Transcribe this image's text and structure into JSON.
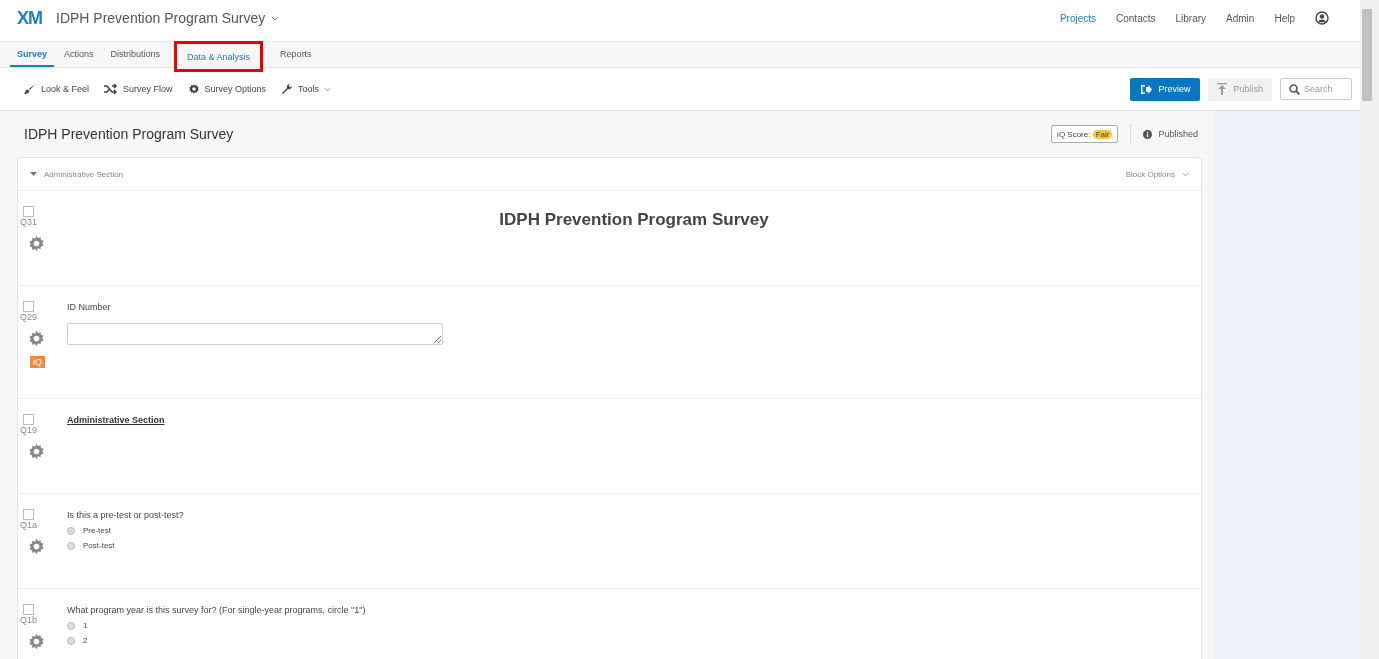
{
  "header": {
    "logo": "XM",
    "project_title": "IDPH Prevention Program Survey",
    "nav": [
      {
        "label": "Projects",
        "selected": true
      },
      {
        "label": "Contacts",
        "selected": false
      },
      {
        "label": "Library",
        "selected": false
      },
      {
        "label": "Admin",
        "selected": false
      },
      {
        "label": "Help",
        "selected": false
      }
    ]
  },
  "tabs": [
    {
      "label": "Survey",
      "selected": true,
      "highlighted": false
    },
    {
      "label": "Actions",
      "selected": false,
      "highlighted": false
    },
    {
      "label": "Distributions",
      "selected": false,
      "highlighted": false
    },
    {
      "label": "Data & Analysis",
      "selected": false,
      "highlighted": true
    },
    {
      "label": "Reports",
      "selected": false,
      "highlighted": false
    }
  ],
  "toolbar": {
    "items": [
      {
        "label": "Look & Feel",
        "kind": "brush",
        "dropdown": false
      },
      {
        "label": "Survey Flow",
        "kind": "flow",
        "dropdown": false
      },
      {
        "label": "Survey Options",
        "kind": "gear",
        "dropdown": false
      },
      {
        "label": "Tools",
        "kind": "wrench",
        "dropdown": true
      }
    ],
    "preview": "Preview",
    "publish": {
      "label": "Publish",
      "disabled": true
    },
    "search": {
      "placeholder": "Search"
    }
  },
  "survey": {
    "title": "IDPH Prevention Program Survey",
    "iq_score": {
      "label": "iQ Score:",
      "value": "Fair"
    },
    "status": "Published"
  },
  "block": {
    "name": "Administrative Section",
    "options": "Block Options",
    "questions": [
      {
        "id": "Q31",
        "kind": "title",
        "text": "IDPH Prevention Program Survey",
        "checked": false
      },
      {
        "id": "Q29",
        "kind": "text_entry",
        "text": "ID Number",
        "checked": false,
        "iq_label": "iQ"
      },
      {
        "id": "Q19",
        "kind": "heading",
        "text": "Administrative Section",
        "checked": false
      },
      {
        "id": "Q1a",
        "kind": "choice",
        "text": "Is this a pre-test or post-test?",
        "checked": false,
        "choices": [
          {
            "label": "Pre-test",
            "selected": false
          },
          {
            "label": "Post-test",
            "selected": false
          }
        ]
      },
      {
        "id": "Q1b",
        "kind": "choice",
        "text": "What program year is this survey for? (For single-year programs, circle \"1\")",
        "checked": false,
        "choices": [
          {
            "label": "1",
            "selected": false
          },
          {
            "label": "2",
            "selected": false
          }
        ]
      }
    ]
  }
}
